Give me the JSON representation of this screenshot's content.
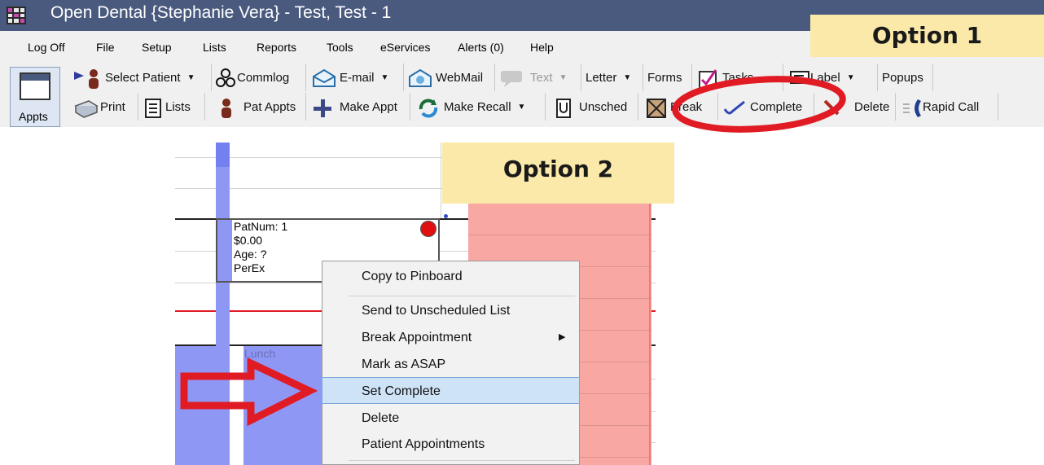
{
  "window": {
    "title": "Open Dental {Stephanie Vera} - Test, Test - 1"
  },
  "menu": {
    "items": [
      "Log Off",
      "File",
      "Setup",
      "Lists",
      "Reports",
      "Tools",
      "eServices",
      "Alerts (0)",
      "Help"
    ]
  },
  "callouts": {
    "option1": "Option 1",
    "option2": "Option 2"
  },
  "toolbar": {
    "appts_label": "Appts",
    "row1": {
      "select_patient": "Select Patient",
      "commlog": "Commlog",
      "email": "E-mail",
      "webmail": "WebMail",
      "text": "Text",
      "letter": "Letter",
      "forms": "Forms",
      "tasks": "Tasks",
      "label": "Label",
      "popups": "Popups"
    },
    "row2": {
      "print": "Print",
      "lists": "Lists",
      "pat_appts": "Pat Appts",
      "make_appt": "Make Appt",
      "make_recall": "Make Recall",
      "unsched": "Unsched",
      "break": "Break",
      "complete": "Complete",
      "delete": "Delete",
      "rapid_call": "Rapid Call"
    }
  },
  "appointment": {
    "lines": [
      "PatNum: 1",
      "$0.00",
      "Age: ?",
      "PerEx"
    ]
  },
  "schedule": {
    "lunch_label": "Lunch"
  },
  "context_menu": {
    "items": [
      "Copy to Pinboard",
      "Send to Unscheduled List",
      "Break Appointment",
      "Mark as ASAP",
      "Set Complete",
      "Delete",
      "Patient Appointments"
    ],
    "highlighted": "Set Complete"
  },
  "colors": {
    "title_bar": "#4a5a7e",
    "callout_bg": "#fbe9a9",
    "operatory_blue": "#8f97f5",
    "blocked_pink": "#f9a7a2",
    "highlight_ring": "#e01b24",
    "menu_highlight": "#cfe3f7"
  }
}
